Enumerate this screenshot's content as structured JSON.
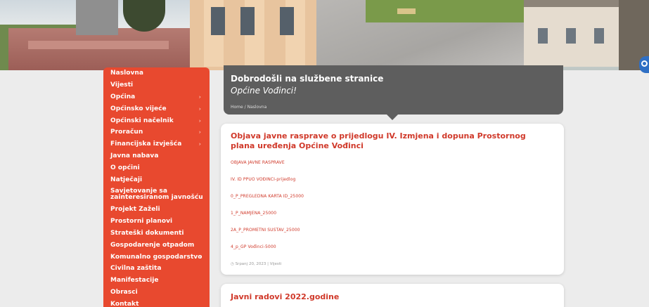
{
  "nav": [
    {
      "label": "Naslovna",
      "sub": false
    },
    {
      "label": "Vijesti",
      "sub": false
    },
    {
      "label": "Općina",
      "sub": true
    },
    {
      "label": "Općinsko vijeće",
      "sub": true
    },
    {
      "label": "Općinski načelnik",
      "sub": true
    },
    {
      "label": "Proračun",
      "sub": true
    },
    {
      "label": "Financijska izvješća",
      "sub": true
    },
    {
      "label": "Javna nabava",
      "sub": false
    },
    {
      "label": "O općini",
      "sub": false
    },
    {
      "label": "Natječaji",
      "sub": false
    },
    {
      "label": "Savjetovanje sa zainteresiranom javnošću",
      "sub": false
    },
    {
      "label": "Projekt Zaželi",
      "sub": false
    },
    {
      "label": "Prostorni planovi",
      "sub": false
    },
    {
      "label": "Strateški dokumenti",
      "sub": false
    },
    {
      "label": "Gospodarenje otpadom",
      "sub": false
    },
    {
      "label": "Komunalno gospodarstvo",
      "sub": true
    },
    {
      "label": "Civilna zaštita",
      "sub": false
    },
    {
      "label": "Manifestacije",
      "sub": false
    },
    {
      "label": "Obrasci",
      "sub": false
    },
    {
      "label": "Kontakt",
      "sub": false
    }
  ],
  "welcome": {
    "title": "Dobrodošli na službene stranice",
    "subtitle": "Općine Vođinci!",
    "breadcrumb_home": "Home",
    "breadcrumb_sep": "/",
    "breadcrumb_current": "Naslovna"
  },
  "posts": [
    {
      "title": "Objava javne rasprave o prijedlogu IV. Izmjena i dopuna Prostornog plana uređenja Općine Vođinci",
      "attachments": [
        "OBJAVA JAVNE RASPRAVE",
        "IV. ID PPUO VOĐINCI-prijedlog",
        "0_p_PREGLEDNA KARTA ID_25000",
        "1_p_NAMJENA_25000",
        "2A_p_PROMETNI SUSTAV_25000",
        "4_p_GP Vođinci-5000"
      ],
      "meta": "Srpanj 20, 2023 | Vijesti"
    },
    {
      "title": "Javni radovi 2022.godine"
    }
  ],
  "colors": {
    "accent": "#e8492f",
    "link": "#d0392a",
    "header_bg": "#5e5e5e"
  }
}
